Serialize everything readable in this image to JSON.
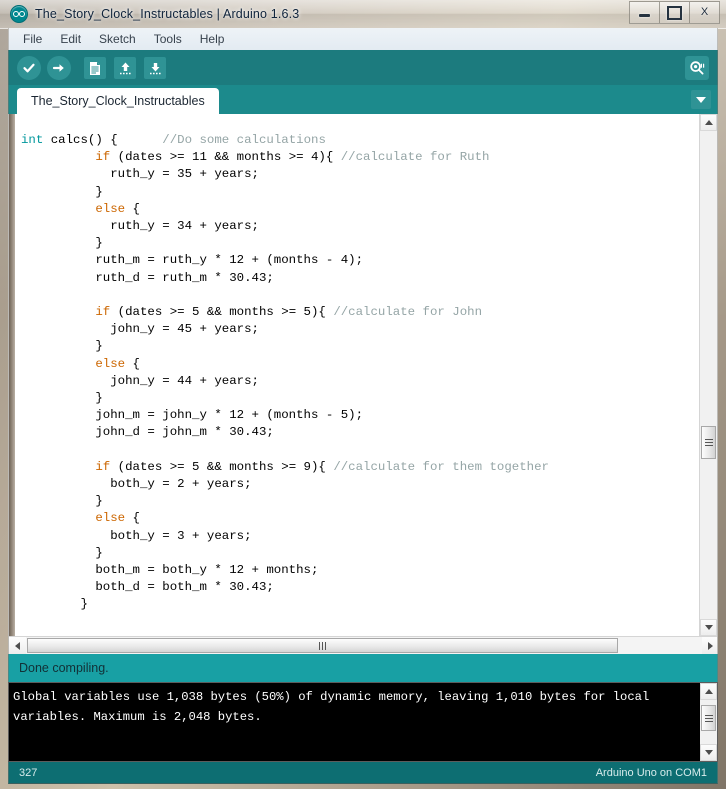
{
  "window": {
    "title": "The_Story_Clock_Instructables | Arduino 1.6.3",
    "icon": "arduino-infinity-icon",
    "minimize_label": "Minimize",
    "maximize_label": "Maximize",
    "close_label": "X"
  },
  "menu": {
    "items": [
      {
        "label": "File"
      },
      {
        "label": "Edit"
      },
      {
        "label": "Sketch"
      },
      {
        "label": "Tools"
      },
      {
        "label": "Help"
      }
    ]
  },
  "toolbar": {
    "buttons": [
      {
        "name": "verify-button",
        "icon": "checkmark-icon",
        "tooltip": "Verify"
      },
      {
        "name": "upload-button",
        "icon": "arrow-right-icon",
        "tooltip": "Upload"
      },
      {
        "name": "new-button",
        "icon": "new-document-icon",
        "tooltip": "New"
      },
      {
        "name": "open-button",
        "icon": "arrow-up-icon",
        "tooltip": "Open"
      },
      {
        "name": "save-button",
        "icon": "arrow-down-icon",
        "tooltip": "Save"
      }
    ],
    "serial_monitor": {
      "icon": "magnifier-icon",
      "tooltip": "Serial Monitor"
    }
  },
  "tabs": {
    "active": "The_Story_Clock_Instructables",
    "items": [
      {
        "label": "The_Story_Clock_Instructables"
      }
    ],
    "menu_icon": "chevron-down-icon"
  },
  "editor": {
    "code": "int calcs() {      //Do some calculations\n          if (dates >= 11 && months >= 4){ //calculate for Ruth\n            ruth_y = 35 + years;\n          }\n          else {\n            ruth_y = 34 + years;\n          }\n          ruth_m = ruth_y * 12 + (months - 4);\n          ruth_d = ruth_m * 30.43;\n\n          if (dates >= 5 && months >= 5){ //calculate for John\n            john_y = 45 + years;\n          }\n          else {\n            john_y = 44 + years;\n          }\n          john_m = john_y * 12 + (months - 5);\n          john_d = john_m * 30.43;\n\n          if (dates >= 5 && months >= 9){ //calculate for them together\n            both_y = 2 + years;\n          }\n          else {\n            both_y = 3 + years;\n          }\n          both_m = both_y * 12 + months;\n          both_d = both_m * 30.43;\n        }"
  },
  "status": {
    "message": "Done compiling."
  },
  "console": {
    "output": "Global variables use 1,038 bytes (50%) of dynamic memory, leaving 1,010 bytes for local variables. Maximum is 2,048 bytes."
  },
  "bottom": {
    "line_number": "327",
    "board_info": "Arduino Uno on COM1"
  },
  "colors": {
    "toolbar_teal": "#1c7b7e",
    "tabstrip_teal": "#1c8a8c",
    "status_teal": "#18a0a4",
    "bottom_teal": "#0d6e72",
    "icon_teal": "#2f9395",
    "console_bg": "#000000",
    "keyword_orange": "#cc6600",
    "type_cyan": "#00979c",
    "comment_gray": "#95a5a6"
  }
}
